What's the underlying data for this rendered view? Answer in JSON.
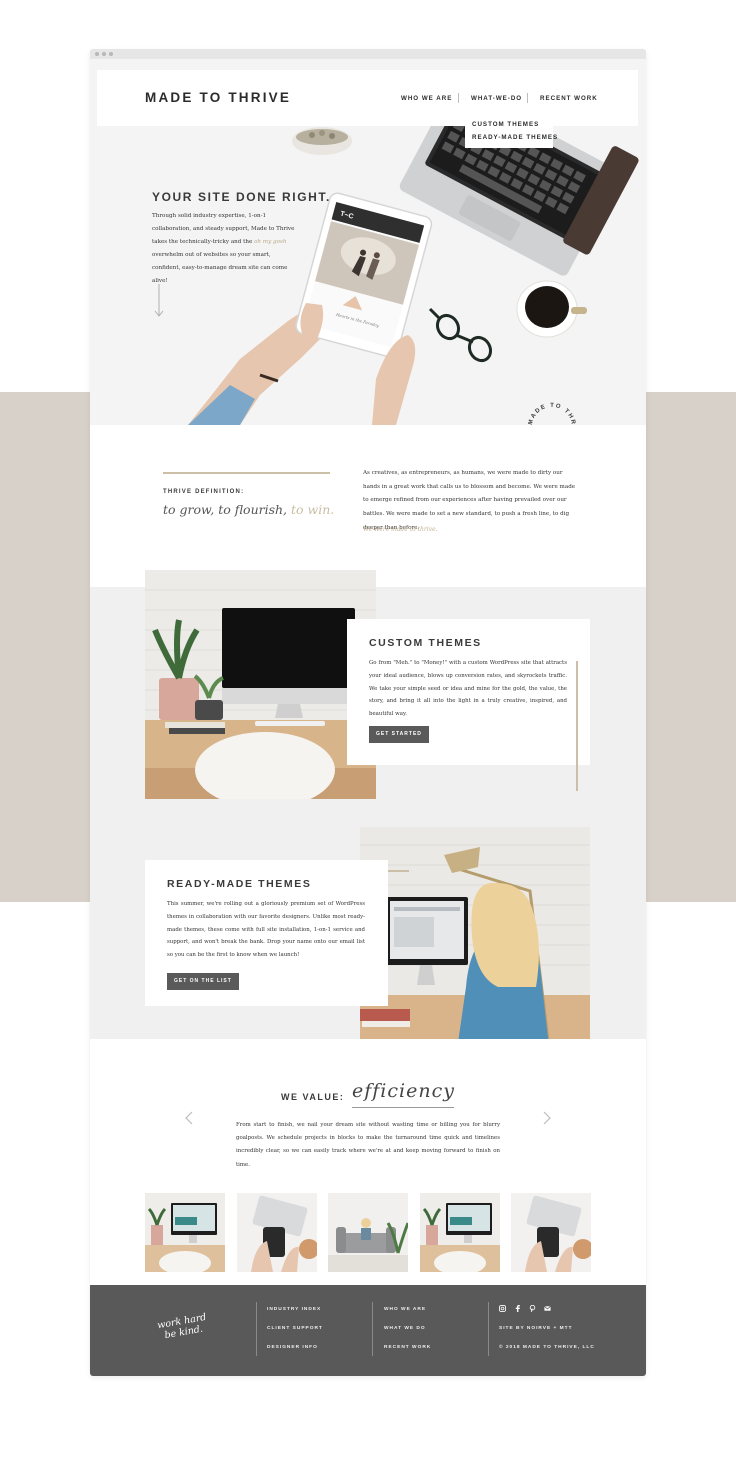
{
  "site": {
    "logo": "MADE TO THRIVE",
    "nav": {
      "items": [
        "WHO WE ARE",
        "WHAT-WE-DO",
        "RECENT WORK"
      ],
      "dropdown": [
        "CUSTOM THEMES",
        "READY-MADE THEMES"
      ]
    }
  },
  "hero": {
    "title": "YOUR SITE DONE RIGHT.",
    "text_before": "Through solid industry expertise, 1-on-1 collaboration, and steady support, Made to Thrive takes the technically-tricky and the ",
    "text_link": "oh my gosh",
    "text_after": " overwhelm out of websites so your smart, confident, easy-to-manage dream site can come alive!",
    "badge_text": "MADE TO THRIVE"
  },
  "definition": {
    "label": "THRIVE DEFINITION:",
    "phrase_main": "to grow, to flourish,",
    "phrase_accent": "to win.",
    "text": "As creatives, as entrepreneurs, as humans, we were made to dirty our hands in a great work that calls us to blossom and become. We were made to emerge refined from our experiences after having prevailed over our battles. We were made to set a new standard, to push a fresh line, to dig deeper than before.",
    "signoff": "We were made to thrive."
  },
  "custom_themes": {
    "title": "CUSTOM THEMES",
    "text": "Go from \"Meh.\" to \"Money!\" with a custom WordPress site that attracts your ideal audience, blows up conversion rates, and skyrockets traffic. We take your simple seed or idea and mine for the gold, the value, the story, and bring it all into the light in a truly creative, inspired, and beautiful way.",
    "button": "GET STARTED"
  },
  "ready_made": {
    "title": "READY-MADE THEMES",
    "text": "This summer, we're rolling out a gloriously premium set of WordPress themes in collaboration with our favorite designers. Unlike most ready-made themes, these come with full site installation, 1-on-1 service and support, and won't break the bank. Drop your name onto our email list so you can be the first to know when we launch!",
    "button": "GET ON THE LIST"
  },
  "values": {
    "label": "WE VALUE:",
    "word": "efficiency",
    "text": "From start to finish, we nail your dream site without wasting time or billing you for blurry goalposts. We schedule projects in blocks to make the turnaround time quick and timelines incredibly clear, so we can easily track where we're at and keep moving forward to finish on time."
  },
  "footer": {
    "script": [
      "work hard",
      "be kind."
    ],
    "col1": [
      "INDUSTRY INDEX",
      "CLIENT SUPPORT",
      "DESIGNER INFO"
    ],
    "col2": [
      "WHO WE ARE",
      "WHAT WE DO",
      "RECENT WORK"
    ],
    "credit": "SITE BY NOIRVE + MTT",
    "copyright": "© 2018 MADE TO THRIVE, LLC",
    "social_icons": [
      "instagram-icon",
      "facebook-icon",
      "pinterest-icon",
      "email-icon"
    ]
  },
  "colors": {
    "band": "#d8d1c9",
    "accent": "#cbbfa8",
    "footer": "#595959",
    "button": "#5a5a5a"
  }
}
